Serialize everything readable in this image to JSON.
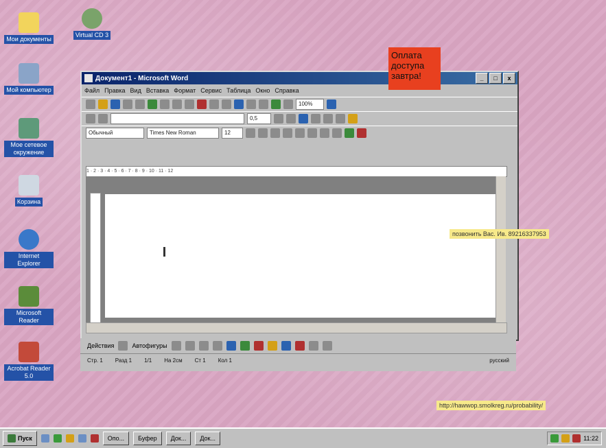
{
  "desktop_icons": [
    {
      "label": "Мои документы"
    },
    {
      "label": "Virtual CD 3"
    },
    {
      "label": "Мой компьютер"
    },
    {
      "label": "Мое сетевое окружение"
    },
    {
      "label": "Корзина"
    },
    {
      "label": "Internet Explorer"
    },
    {
      "label": "Microsoft Reader"
    },
    {
      "label": "Acrobat Reader 5.0"
    }
  ],
  "window": {
    "title": "Документ1 - Microsoft Word",
    "controls": [
      "_",
      "□",
      "x"
    ],
    "menu": [
      "Файл",
      "Правка",
      "Вид",
      "Вставка",
      "Формат",
      "Сервис",
      "Таблица",
      "Окно",
      "Справка"
    ],
    "toolbar": {
      "zoom": "100%",
      "line_weight": "0,5",
      "style": "Обычный",
      "font": "Times New Roman",
      "size": "12"
    },
    "ruler": "1 · 2 · 3 · 4 · 5 · 6 · 7 · 8 · 9 · 10 · 11 · 12",
    "draw_toolbar": {
      "actions": "Действия",
      "autoshapes": "Автофигуры"
    },
    "status": {
      "page": "Стр. 1",
      "section": "Разд 1",
      "pages": "1/1",
      "position": "На 2см",
      "line": "Ст 1",
      "col": "Кол 1",
      "language": "русский"
    }
  },
  "notes": {
    "red": "Оплата доступа завтра!",
    "yellow1": "позвонить Вас. Ив. 89216337953",
    "yellow2": "http://hawwop.smolkreg.ru/probability/"
  },
  "taskbar": {
    "start": "Пуск",
    "buttons": [
      "Опо...",
      "Буфер",
      "Док...",
      "Док..."
    ],
    "clock": "11:22"
  }
}
